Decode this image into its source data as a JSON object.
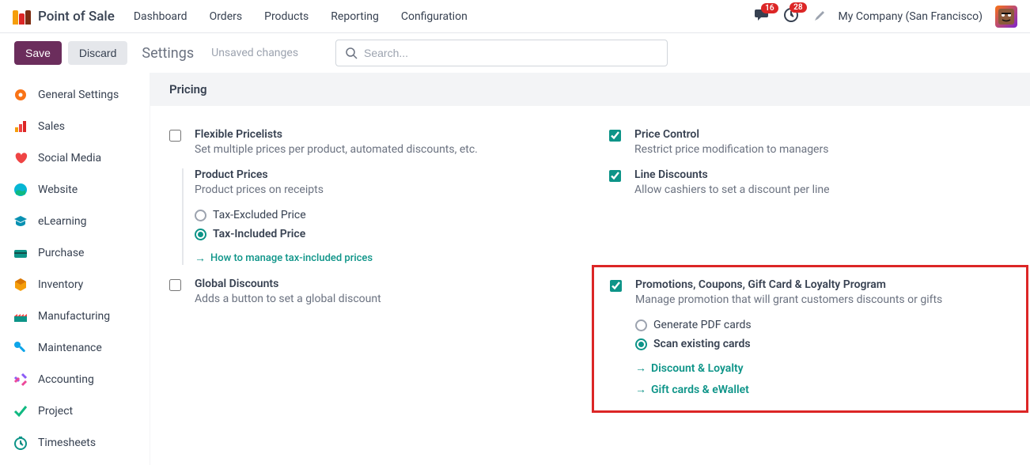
{
  "app": {
    "title": "Point of Sale"
  },
  "nav": {
    "items": [
      "Dashboard",
      "Orders",
      "Products",
      "Reporting",
      "Configuration"
    ]
  },
  "topbar": {
    "messages_count": "16",
    "activities_count": "28",
    "company": "My Company (San Francisco)"
  },
  "actionbar": {
    "save": "Save",
    "discard": "Discard",
    "breadcrumb": "Settings",
    "unsaved": "Unsaved changes",
    "search_placeholder": "Search..."
  },
  "sidebar": {
    "items": [
      {
        "label": "General Settings"
      },
      {
        "label": "Sales"
      },
      {
        "label": "Social Media"
      },
      {
        "label": "Website"
      },
      {
        "label": "eLearning"
      },
      {
        "label": "Purchase"
      },
      {
        "label": "Inventory"
      },
      {
        "label": "Manufacturing"
      },
      {
        "label": "Maintenance"
      },
      {
        "label": "Accounting"
      },
      {
        "label": "Project"
      },
      {
        "label": "Timesheets"
      }
    ]
  },
  "section": {
    "title": "Pricing"
  },
  "settings": {
    "flexible_pricelists": {
      "title": "Flexible Pricelists",
      "desc": "Set multiple prices per product, automated discounts, etc."
    },
    "price_control": {
      "title": "Price Control",
      "desc": "Restrict price modification to managers"
    },
    "product_prices": {
      "title": "Product Prices",
      "desc": "Product prices on receipts",
      "radio1": "Tax-Excluded Price",
      "radio2": "Tax-Included Price",
      "link": "How to manage tax-included prices"
    },
    "line_discounts": {
      "title": "Line Discounts",
      "desc": "Allow cashiers to set a discount per line"
    },
    "global_discounts": {
      "title": "Global Discounts",
      "desc": "Adds a button to set a global discount"
    },
    "promotions": {
      "title": "Promotions, Coupons, Gift Card & Loyalty Program",
      "desc": "Manage promotion that will grant customers discounts or gifts",
      "radio1": "Generate PDF cards",
      "radio2": "Scan existing cards",
      "link1": "Discount & Loyalty",
      "link2": "Gift cards & eWallet"
    }
  }
}
